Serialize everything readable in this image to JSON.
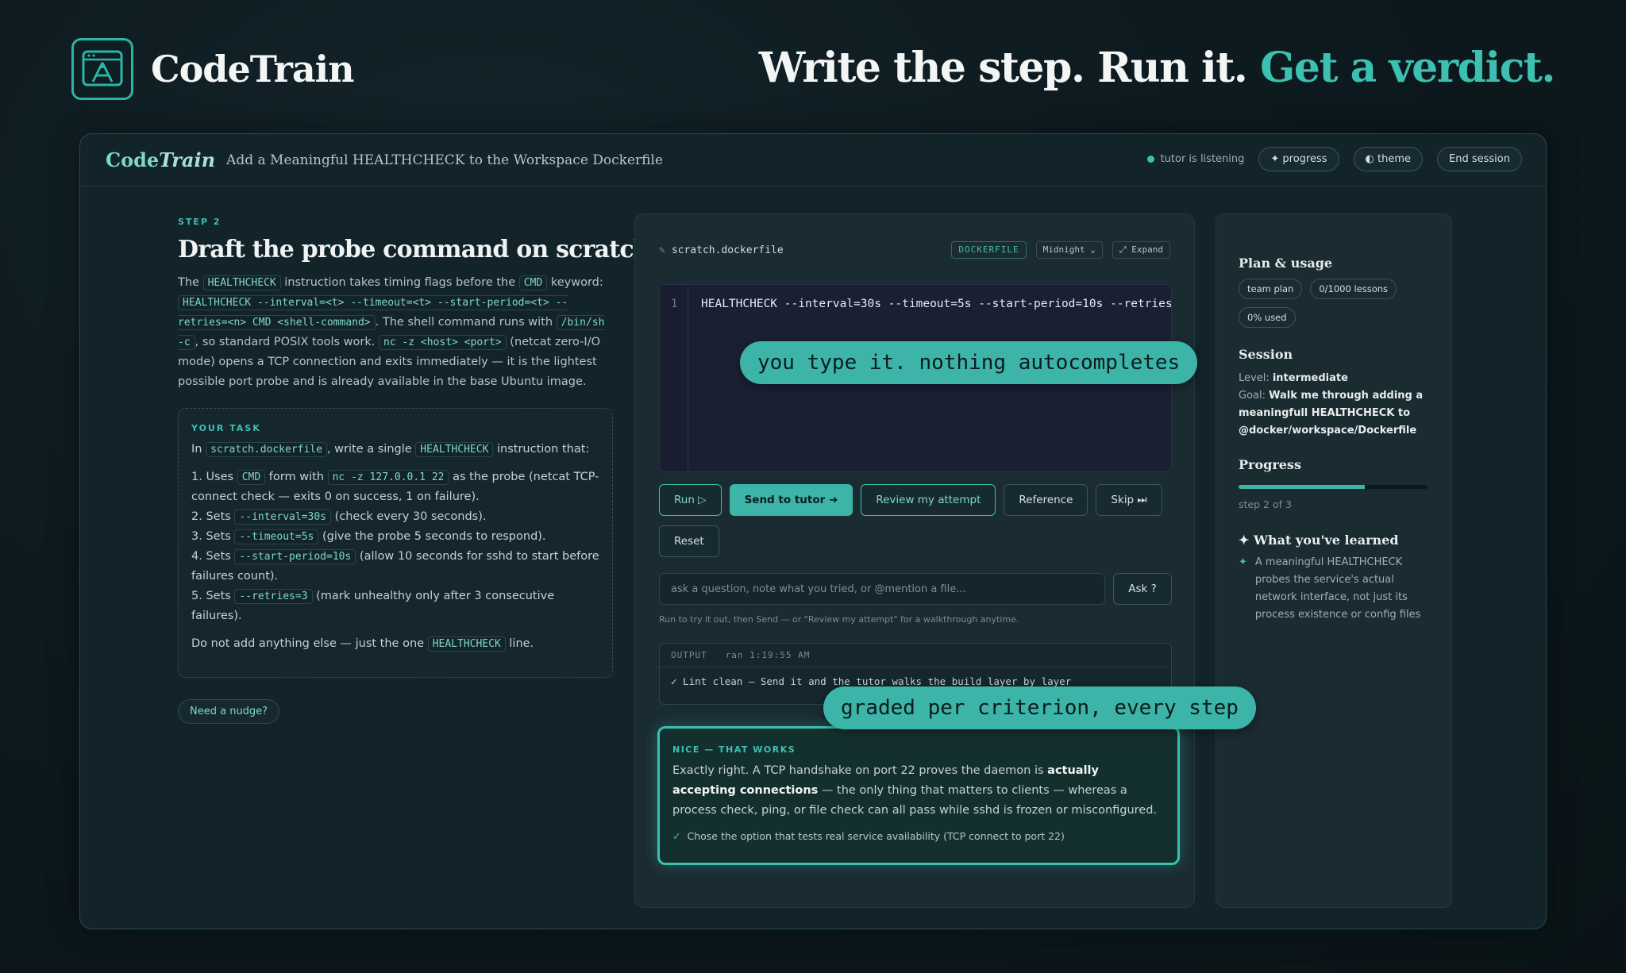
{
  "brand": {
    "name": "CodeTrain"
  },
  "tagline": {
    "lead": "Write the step. Run it.",
    "highlight": "Get a verdict."
  },
  "app": {
    "logo_code": "Code",
    "logo_train": "Train",
    "title": "Add a Meaningful HEALTHCHECK to the Workspace Dockerfile",
    "status": "tutor is listening",
    "progress_btn": "✦ progress",
    "theme_btn": "◐ theme",
    "end_btn": "End session"
  },
  "lesson": {
    "step_label": "STEP 2",
    "title": "Draft the probe command on scratch",
    "intro": [
      "The",
      "HEALTHCHECK",
      "instruction takes timing flags before the",
      "CMD",
      "keyword:",
      "HEALTHCHECK --interval=<t> --timeout=<t> --start-period=<t> --retries=<n> CMD <shell-command>",
      ". The shell command runs with",
      "/bin/sh -c",
      ", so standard POSIX tools work.",
      "nc -z <host> <port>",
      "(netcat zero-I/O mode) opens a TCP connection and exits immediately — it is the lightest possible port probe and is already available in the base Ubuntu image."
    ],
    "task_label": "YOUR TASK",
    "task_intro": [
      "In",
      "scratch.dockerfile",
      ", write a single",
      "HEALTHCHECK",
      "instruction that:"
    ],
    "task_items": [
      [
        "1. Uses",
        "CMD",
        "form with",
        "nc -z 127.0.0.1 22",
        "as the probe (netcat TCP-connect check — exits 0 on success, 1 on failure)."
      ],
      [
        "2. Sets",
        "--interval=30s",
        "(check every 30 seconds)."
      ],
      [
        "3. Sets",
        "--timeout=5s",
        "(give the probe 5 seconds to respond)."
      ],
      [
        "4. Sets",
        "--start-period=10s",
        "(allow 10 seconds for sshd to start before failures count)."
      ],
      [
        "5. Sets",
        "--retries=3",
        "(mark unhealthy only after 3 consecutive failures)."
      ]
    ],
    "task_outro": [
      "Do not add anything else — just the one",
      "HEALTHCHECK",
      "line."
    ],
    "nudge": "Need a nudge?"
  },
  "editor": {
    "filename": "scratch.dockerfile",
    "tag_lang": "DOCKERFILE",
    "tag_theme": "Midnight ⌄",
    "tag_expand": "⤢ Expand",
    "line_no": "1",
    "code": "HEALTHCHECK --interval=30s --timeout=5s --start-period=10s --retries",
    "buttons": {
      "run": "Run ▷",
      "send": "Send to tutor ➜",
      "review": "Review my attempt",
      "reference": "Reference",
      "skip": "Skip ⏭",
      "reset": "Reset"
    },
    "ask_placeholder": "ask a question, note what you tried, or @mention a file...",
    "ask_btn": "Ask ?",
    "hint": "Run to try it out, then Send — or \"Review my attempt\" for a walkthrough anytime.",
    "output_label": "OUTPUT",
    "output_time": "ran 1:19:55 AM",
    "output_line": "✓ Lint clean — Send it and the tutor walks the build layer by layer"
  },
  "verdict": {
    "label": "NICE — THAT WORKS",
    "text_a": "Exactly right. A TCP handshake on port 22 proves the daemon is",
    "text_bold": "actually accepting connections",
    "text_b": "— the only thing that matters to clients — whereas a process check, ping, or file check can all pass while sshd is frozen or misconfigured.",
    "criterion": "Chose the option that tests real service availability (TCP connect to port 22)"
  },
  "callouts": {
    "type": "you type it. nothing autocompletes",
    "graded": "graded per criterion, every step"
  },
  "sidebar": {
    "plan_title": "Plan & usage",
    "chips": [
      "team plan",
      "0/1000 lessons",
      "0% used"
    ],
    "session_title": "Session",
    "level_label": "Level:",
    "level": "intermediate",
    "goal_label": "Goal:",
    "goal": "Walk me through adding a meaningfull HEALTHCHECK to @docker/workspace/Dockerfile",
    "progress_title": "Progress",
    "progress_fraction": 0.67,
    "progress_text": "step 2 of 3",
    "learned_title": "✦ What you've learned",
    "learned_item": "A meaningful HEALTHCHECK probes the service's actual network interface, not just its process existence or config files"
  }
}
